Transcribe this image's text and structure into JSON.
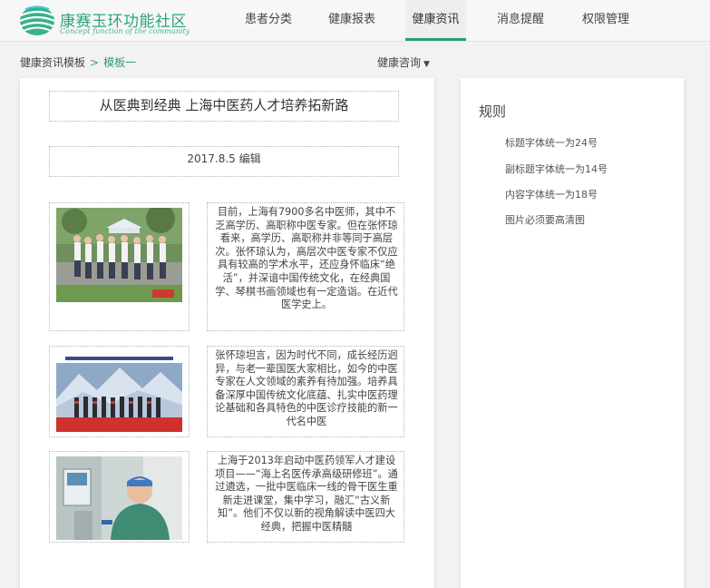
{
  "header": {
    "logo_title": "康赛玉环功能社区",
    "logo_subtitle": "Concept function of the community",
    "nav": [
      {
        "label": "患者分类",
        "active": false
      },
      {
        "label": "健康报表",
        "active": false
      },
      {
        "label": "健康资讯",
        "active": true
      },
      {
        "label": "消息提醒",
        "active": false
      },
      {
        "label": "权限管理",
        "active": false
      }
    ]
  },
  "breadcrumb": {
    "root": "健康资讯模板",
    "separator": ">",
    "current": "模板一"
  },
  "consult_dropdown": {
    "label": "健康咨询",
    "caret": "▼"
  },
  "article": {
    "title": "从医典到经典 上海中医药人才培养拓新路",
    "date_line": "2017.8.5 编辑",
    "sections": [
      {
        "image_icon": "photo-group-outdoor",
        "text": "目前，上海有7900多名中医师，其中不乏高学历、高职称中医专家。但在张怀琼看来，高学历、高职称并非等同于高层次。张怀琼认为，高层次中医专家不仅应具有较高的学术水平，还应身怀临床“绝活”，并深谙中国传统文化，在经典国学、琴棋书画领域也有一定造诣。在近代医学史上。"
      },
      {
        "image_icon": "photo-ceremony-stage",
        "text": "张怀琼坦言，因为时代不同，成长经历迥异，与老一辈国医大家相比，如今的中医专家在人文领域的素养有待加强。培养具备深厚中国传统文化底蕴、扎实中医药理论基础和各具特色的中医诊疗技能的新一代名中医"
      },
      {
        "image_icon": "photo-doctor-clinic",
        "text": "上海于2013年启动中医药领军人才建设项目——“海上名医传承高级研修班”。通过遴选，一批中医临床一线的骨干医生重新走进课堂，集中学习，融汇“古义新知”。他们不仅以新的视角解读中医四大经典，把握中医精髓"
      }
    ]
  },
  "rules": {
    "title": "规则",
    "items": [
      "标题字体统一为24号",
      "副标题字体统一为14号",
      "内容字体统一为18号",
      "图片必须要高清图"
    ]
  },
  "colors": {
    "brand": "#2aa57a",
    "active_underline": "#2a9d76",
    "background": "#f2f2f2"
  }
}
